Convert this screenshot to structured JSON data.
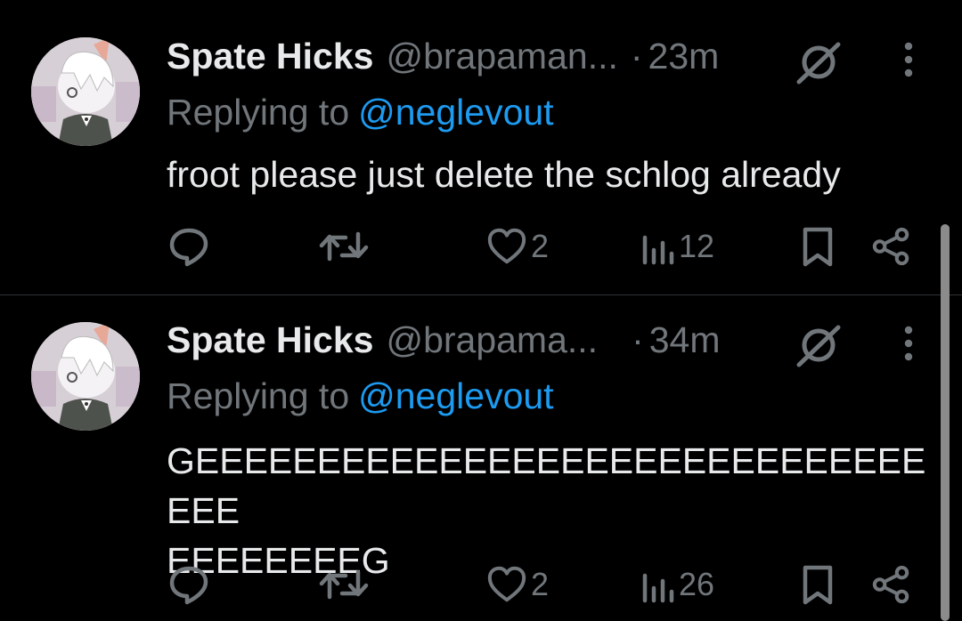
{
  "tweets": [
    {
      "display_name": "Spate Hicks",
      "handle": "@brapaman...",
      "separator": "·",
      "time": "23m",
      "replying_label": "Replying to",
      "replying_to": "@neglevout",
      "text_lines": [
        "froot please just delete the schlog already"
      ],
      "likes": "2",
      "views": "12"
    },
    {
      "display_name": "Spate Hicks",
      "handle": "@brapama...",
      "separator": "·",
      "time": "34m",
      "replying_label": "Replying to",
      "replying_to": "@neglevout",
      "text_lines": [
        "GEEEEEEEEEEEEEEEEEEEEEEEEEEEEEEEEE",
        "EEEEEEEEG"
      ],
      "likes": "2",
      "views": "26"
    }
  ],
  "icons": {
    "badge": "slashed-circle-icon",
    "more": "more-vertical-icon",
    "reply": "reply-icon",
    "retweet": "retweet-icon",
    "like": "heart-icon",
    "views": "views-icon",
    "bookmark": "bookmark-icon",
    "share": "share-icon"
  },
  "colors": {
    "background": "#000000",
    "text": "#e7e9ea",
    "muted": "#71767b",
    "link": "#1d9bf0",
    "divider": "#2f3336"
  }
}
